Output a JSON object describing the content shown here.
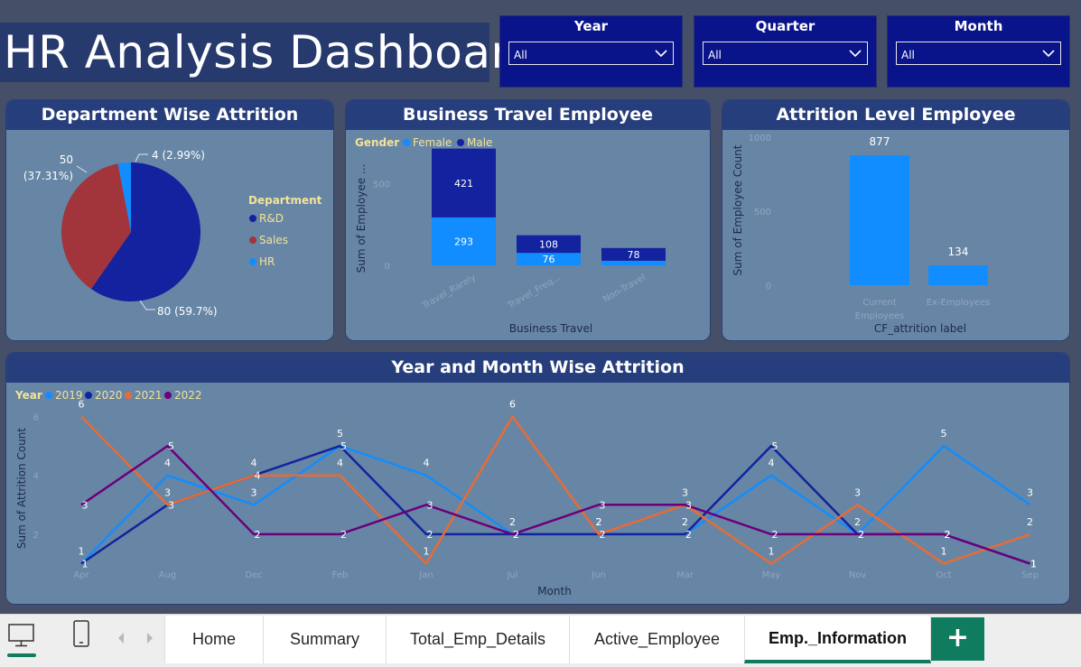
{
  "title": "HR Analysis Dashboard",
  "slicers": [
    {
      "label": "Year",
      "value": "All"
    },
    {
      "label": "Quarter",
      "value": "All"
    },
    {
      "label": "Month",
      "value": "All"
    }
  ],
  "colors": {
    "rd": "#13229e",
    "sales": "#a2343c",
    "hr": "#118dff",
    "female": "#118dff",
    "male": "#13229e",
    "y2019": "#118dff",
    "y2020": "#12239e",
    "y2021": "#e66c37",
    "y2022": "#6b007b"
  },
  "tabs": [
    "Home",
    "Summary",
    "Total_Emp_Details",
    "Active_Employee",
    "Emp._Information"
  ],
  "active_tab": "Emp._Information",
  "add_tab_label": "+",
  "chart_data": [
    {
      "type": "pie",
      "title": "Department Wise Attrition",
      "legend_title": "Department",
      "legend_position": "right",
      "slices": [
        {
          "label": "R&D",
          "value": 80,
          "display": "80 (59.7%)"
        },
        {
          "label": "Sales",
          "value": 50,
          "display": "50 (37.31%)"
        },
        {
          "label": "HR",
          "value": 4,
          "display": "4 (2.99%)"
        }
      ]
    },
    {
      "type": "bar",
      "stacked": true,
      "title": "Business Travel Employee",
      "legend_title": "Gender",
      "legend_position": "top-left",
      "xlabel": "Business Travel",
      "ylabel": "Sum of Employee ...",
      "categories": [
        "Travel_Rarely",
        "Travel_Freq...",
        "Non-Travel"
      ],
      "series": [
        {
          "name": "Female",
          "values": [
            293,
            76,
            28
          ]
        },
        {
          "name": "Male",
          "values": [
            421,
            108,
            78
          ]
        }
      ],
      "yticks": [
        0,
        500
      ],
      "ylim": [
        0,
        850
      ]
    },
    {
      "type": "bar",
      "title": "Attrition Level Employee",
      "xlabel": "CF_attrition label",
      "ylabel": "Sum of Employee Count",
      "categories": [
        "Current Employees",
        "Ex-Employees"
      ],
      "values": [
        877,
        134
      ],
      "yticks": [
        0,
        500,
        1000
      ],
      "ylim": [
        0,
        1000
      ]
    },
    {
      "type": "line",
      "title": "Year and Month Wise Attrition",
      "legend_title": "Year",
      "legend_position": "top-left",
      "xlabel": "Month",
      "ylabel": "Sum of Attrition Count",
      "categories": [
        "Apr",
        "Aug",
        "Dec",
        "Feb",
        "Jan",
        "Jul",
        "Jun",
        "Mar",
        "May",
        "Nov",
        "Oct",
        "Sep"
      ],
      "yticks": [
        2,
        4,
        6
      ],
      "ylim": [
        0.8,
        6.2
      ],
      "series": [
        {
          "name": "2019",
          "values": [
            1,
            4,
            3,
            5,
            4,
            2,
            2,
            2,
            4,
            2,
            5,
            3
          ]
        },
        {
          "name": "2020",
          "values": [
            1,
            3,
            4,
            5,
            2,
            2,
            2,
            2,
            5,
            2,
            2,
            1
          ]
        },
        {
          "name": "2021",
          "values": [
            6,
            3,
            4,
            4,
            1,
            6,
            2,
            3,
            1,
            3,
            1,
            2
          ]
        },
        {
          "name": "2022",
          "values": [
            3,
            5,
            2,
            2,
            3,
            2,
            3,
            3,
            2,
            2,
            2,
            1
          ]
        }
      ]
    }
  ]
}
